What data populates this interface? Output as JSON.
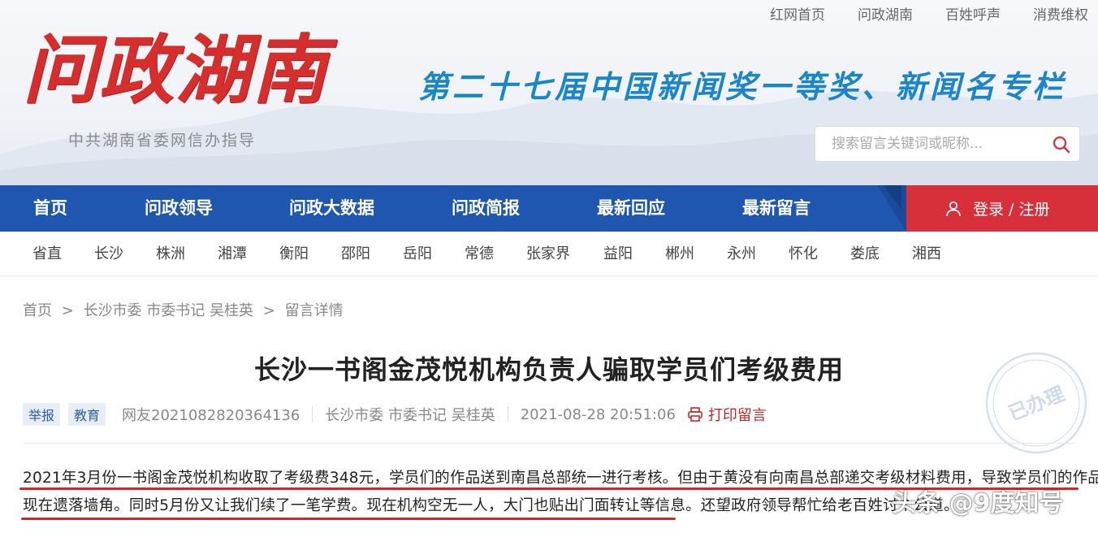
{
  "toplinks": [
    "红网首页",
    "问政湖南",
    "百姓呼声",
    "消费维权"
  ],
  "logo": {
    "title": "问政湖南",
    "subtitle": "中共湖南省委网信办指导"
  },
  "slogan": "第二十七届中国新闻奖一等奖、新闻名专栏",
  "search": {
    "placeholder": "搜索留言关键词或昵称...",
    "value": ""
  },
  "nav": {
    "items": [
      "首页",
      "问政领导",
      "问政大数据",
      "问政简报",
      "最新回应",
      "最新留言"
    ],
    "login_label": "登录 / 注册"
  },
  "cities": [
    "省直",
    "长沙",
    "株洲",
    "湘潭",
    "衡阳",
    "邵阳",
    "岳阳",
    "常德",
    "张家界",
    "益阳",
    "郴州",
    "永州",
    "怀化",
    "娄底",
    "湘西"
  ],
  "breadcrumb": [
    "首页",
    ">",
    "长沙市委 市委书记 吴桂英",
    ">",
    "留言详情"
  ],
  "article": {
    "title": "长沙一书阁金茂悦机构负责人骗取学员们考级费用",
    "tags": [
      "举报",
      "教育"
    ],
    "author": "网友2021082820364136",
    "target": "长沙市委 市委书记 吴桂英",
    "datetime": "2021-08-28 20:51:06",
    "print_label": "打印留言",
    "stamp_label": "已办理",
    "paragraphs": [
      "2021年3月份一书阁金茂悦机构收取了考级费348元，学员们的作品送到南昌总部统一进行考核。但由于黄没有向南昌总部递交考级材料费用，导致学员们的作品",
      "现在遗落墙角。同时5月份又让我们续了一笔学费。现在机构空无一人，大门也贴出门面转让等信息。还望政府领导帮忙给老百姓讨个公道。"
    ]
  },
  "watermark": "头条 @9度知号",
  "colors": {
    "nav_blue": "#1e56b0",
    "login_red": "#d8303a",
    "logo_red": "#d62d2d",
    "slogan_blue": "#1a86c9",
    "underline_red": "#d8232a"
  }
}
